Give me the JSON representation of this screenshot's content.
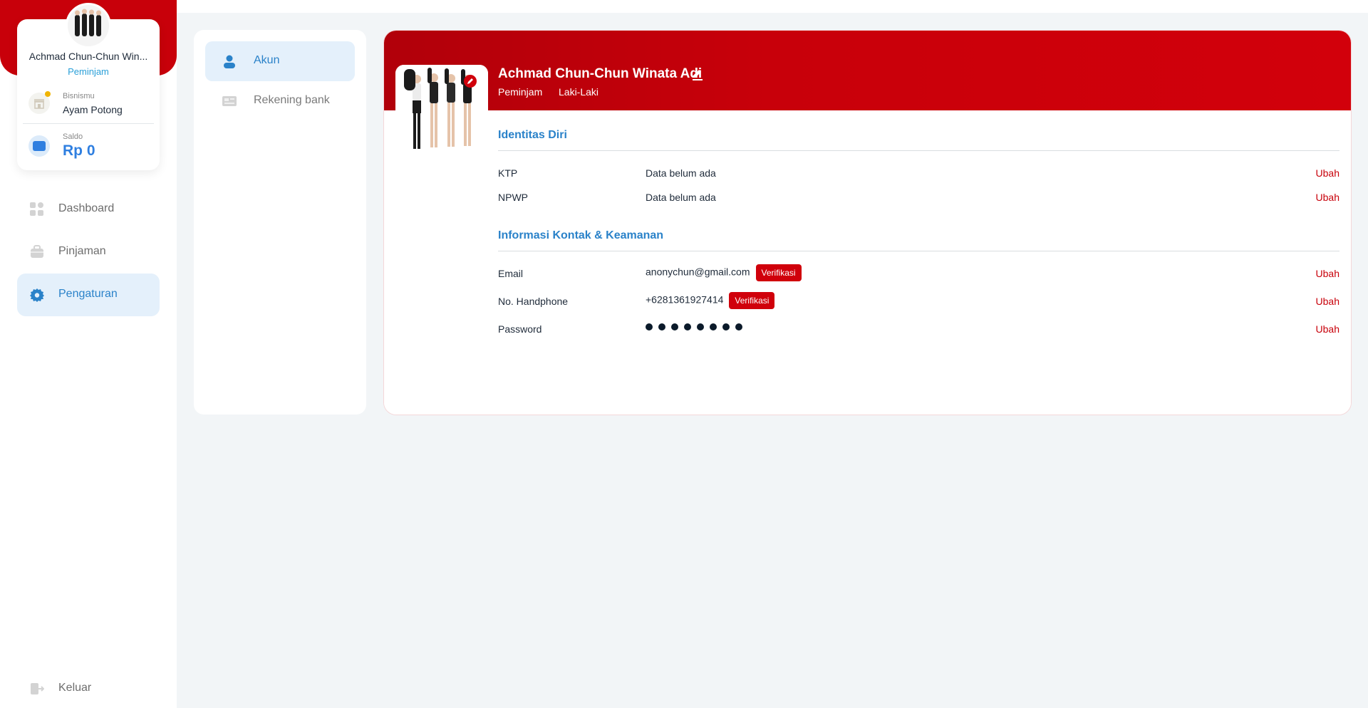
{
  "sidebar": {
    "profile": {
      "name": "Achmad Chun-Chun Win...",
      "role": "Peminjam",
      "business_label": "Bisnismu",
      "business_value": "Ayam Potong",
      "balance_label": "Saldo",
      "balance_value": "Rp 0"
    },
    "nav": [
      {
        "label": "Dashboard",
        "icon": "grid-icon"
      },
      {
        "label": "Pinjaman",
        "icon": "briefcase-icon"
      },
      {
        "label": "Pengaturan",
        "icon": "gear-icon",
        "active": true
      }
    ],
    "logout_label": "Keluar"
  },
  "settings_menu": [
    {
      "label": "Akun",
      "icon": "user-icon",
      "active": true
    },
    {
      "label": "Rekening bank",
      "icon": "bank-card-icon"
    }
  ],
  "account": {
    "name": "Achmad Chun-Chun Winata Adi",
    "role": "Peminjam",
    "gender": "Laki-Laki",
    "identity_title": "Identitas Diri",
    "identity_rows": [
      {
        "label": "KTP",
        "value": "Data belum ada",
        "action": "Ubah"
      },
      {
        "label": "NPWP",
        "value": "Data belum ada",
        "action": "Ubah"
      }
    ],
    "contact_title": "Informasi Kontak & Keamanan",
    "contact_rows": [
      {
        "label": "Email",
        "value": "anonychun@gmail.com",
        "badge": "Verifikasi",
        "action": "Ubah"
      },
      {
        "label": "No. Handphone",
        "value": "+6281361927414",
        "badge": "Verifikasi",
        "action": "Ubah"
      },
      {
        "label": "Password",
        "value": "",
        "action": "Ubah"
      }
    ]
  },
  "colors": {
    "brand_red": "#c8000a",
    "accent_blue": "#2a82c9",
    "balance_blue": "#2f7fe0"
  }
}
